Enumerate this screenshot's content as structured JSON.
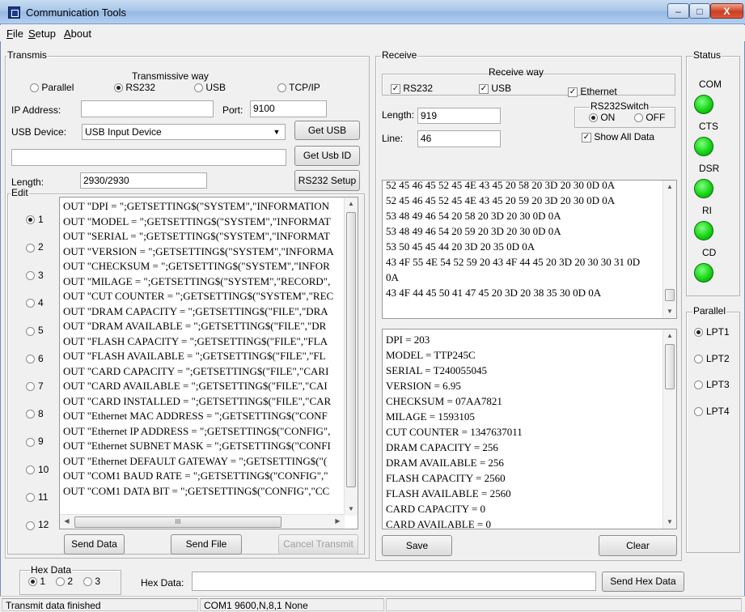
{
  "window": {
    "title": "Communication Tools",
    "min": "–",
    "max": "□",
    "close": "X"
  },
  "menu": [
    {
      "label": "File",
      "key": "F",
      "rest": "ile"
    },
    {
      "label": "Setup",
      "key": "S",
      "rest": "etup"
    },
    {
      "label": "About",
      "key": "A",
      "rest": "bout"
    }
  ],
  "transmis": {
    "group_label": "Transmis",
    "way_label": "Transmissive way",
    "ways": [
      {
        "label": "Parallel",
        "selected": false
      },
      {
        "label": "RS232",
        "selected": true
      },
      {
        "label": "USB",
        "selected": false
      },
      {
        "label": "TCP/IP",
        "selected": false
      }
    ],
    "ip_label": "IP Address:",
    "ip_value": "",
    "port_label": "Port:",
    "port_value": "9100",
    "usb_label": "USB Device:",
    "usb_value": "USB Input Device",
    "get_usb": "Get USB",
    "usb_id_value": "",
    "get_usb_id": "Get Usb ID",
    "length_label": "Length:",
    "length_value": "2930/2930",
    "rs232_setup": "RS232 Setup"
  },
  "edit": {
    "group_label": "Edit",
    "slots": [
      "1",
      "2",
      "3",
      "4",
      "5",
      "6",
      "7",
      "8",
      "9",
      "10",
      "11",
      "12"
    ],
    "selected_slot": "1",
    "lines": [
      "OUT \"DPI = \";GETSETTING$(\"SYSTEM\",\"INFORMATION",
      "OUT \"MODEL = \";GETSETTING$(\"SYSTEM\",\"INFORMAT",
      "OUT \"SERIAL = \";GETSETTING$(\"SYSTEM\",\"INFORMAT",
      "OUT \"VERSION = \";GETSETTING$(\"SYSTEM\",\"INFORMA",
      "OUT \"CHECKSUM = \";GETSETTING$(\"SYSTEM\",\"INFOR",
      "OUT \"MILAGE = \";GETSETTING$(\"SYSTEM\",\"RECORD\",",
      "OUT \"CUT COUNTER = \";GETSETTING$(\"SYSTEM\",\"REC",
      "OUT \"DRAM CAPACITY = \";GETSETTING$(\"FILE\",\"DRA",
      "OUT \"DRAM AVAILABLE = \";GETSETTING$(\"FILE\",\"DR",
      "OUT \"FLASH CAPACITY = \";GETSETTING$(\"FILE\",\"FLA",
      "OUT \"FLASH AVAILABLE = \";GETSETTING$(\"FILE\",\"FL",
      "OUT \"CARD CAPACITY = \";GETSETTING$(\"FILE\",\"CARI",
      "OUT \"CARD AVAILABLE = \";GETSETTING$(\"FILE\",\"CAI",
      "OUT \"CARD INSTALLED = \";GETSETTING$(\"FILE\",\"CAR",
      "OUT \"Ethernet MAC ADDRESS = \";GETSETTING$(\"CONF",
      "OUT \"Ethernet IP ADDRESS = \";GETSETTING$(\"CONFIG\",",
      "OUT \"Ethernet SUBNET MASK = \";GETSETTING$(\"CONFI",
      "OUT \"Ethernet DEFAULT GATEWAY = \";GETSETTING$(\"(",
      "OUT \"COM1 BAUD RATE = \";GETSETTING$(\"CONFIG\",\"",
      "OUT \"COM1 DATA BIT = \";GETSETTING$(\"CONFIG\",\"CC"
    ],
    "hscroll_grip": "III",
    "send_data": "Send Data",
    "send_file": "Send File",
    "cancel_transmit": "Cancel Transmit"
  },
  "receive": {
    "group_label": "Receive",
    "way_label": "Receive way",
    "rs232": "RS232",
    "usb": "USB",
    "ethernet": "Ethernet",
    "switch_label": "RS232Switch",
    "on": "ON",
    "off": "OFF",
    "length_label": "Length:",
    "length_value": "919",
    "line_label": "Line:",
    "line_value": "46",
    "show_all": "Show All Data",
    "hex_lines": [
      "52 45 46 45 52 45 4E 43 45 20 58 20 3D 20 30 0D 0A",
      "52 45 46 45 52 45 4E 43 45 20 59 20 3D 20 30 0D 0A",
      "53 48 49 46 54 20 58 20 3D 20 30 0D 0A",
      "53 48 49 46 54 20 59 20 3D 20 30 0D 0A",
      "53 50 45 45 44 20 3D 20 35 0D 0A",
      "43 4F 55 4E 54 52 59 20 43 4F 44 45 20 3D 20 30 30 31 0D",
      "0A",
      "43 4F 44 45 50 41 47 45 20 3D 20 38 35 30 0D 0A"
    ],
    "text_lines": [
      "DPI = 203",
      "MODEL = TTP245C",
      "SERIAL = T240055045",
      "VERSION = 6.95",
      "CHECKSUM = 07AA7821",
      "MILAGE = 1593105",
      "CUT COUNTER = 1347637011",
      "DRAM CAPACITY = 256",
      "DRAM AVAILABLE = 256",
      "FLASH CAPACITY = 2560",
      "FLASH AVAILABLE = 2560",
      "CARD CAPACITY = 0",
      "CARD AVAILABLE = 0"
    ],
    "save": "Save",
    "clear": "Clear"
  },
  "status": {
    "group_label": "Status",
    "indicators": [
      "COM",
      "CTS",
      "DSR",
      "RI",
      "CD"
    ],
    "led_color": "#10d010"
  },
  "parallel": {
    "group_label": "Parallel",
    "ports": [
      "LPT1",
      "LPT2",
      "LPT3",
      "LPT4"
    ],
    "selected": "LPT1"
  },
  "hexdata": {
    "group_label": "Hex Data",
    "options": [
      "1",
      "2",
      "3"
    ],
    "selected": "1",
    "label": "Hex Data:",
    "value": "",
    "send": "Send Hex Data"
  },
  "statusbar": {
    "left": "Transmit data finished",
    "middle": "COM1 9600,N,8,1 None"
  }
}
